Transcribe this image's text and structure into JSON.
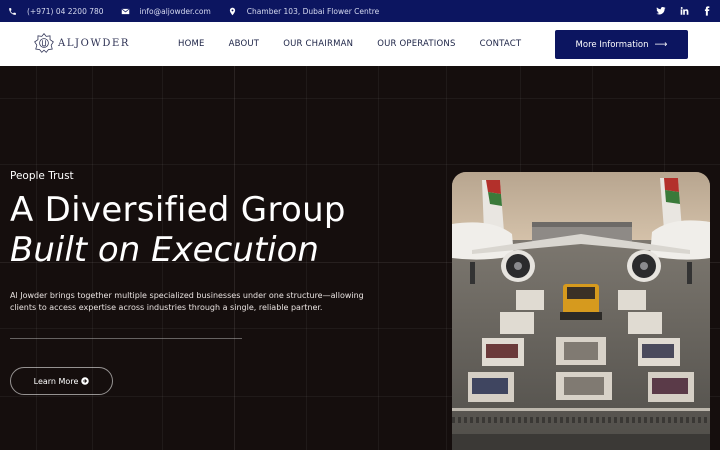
{
  "topbar": {
    "phone": "(+971) 04 2200 780",
    "email": "info@aljowder.com",
    "address": "Chamber 103, Dubai Flower Centre",
    "social": [
      "twitter-icon",
      "linkedin-icon",
      "facebook-icon"
    ]
  },
  "header": {
    "logo_text": "ALJOWDER",
    "nav": [
      "HOME",
      "ABOUT",
      "OUR CHAIRMAN",
      "OUR OPERATIONS",
      "CONTACT"
    ],
    "cta_label": "More Information"
  },
  "hero": {
    "eyebrow": "People Trust",
    "title_line1": "A Diversified Group",
    "title_line2": "Built on Execution",
    "description": "Al Jowder brings together multiple specialized businesses under one structure—allowing clients to access expertise across industries through a single, reliable partner.",
    "button_label": "Learn More"
  },
  "colors": {
    "brand_navy": "#0c1560",
    "hero_bg": "#150e0d",
    "text_light": "#ffffff"
  }
}
